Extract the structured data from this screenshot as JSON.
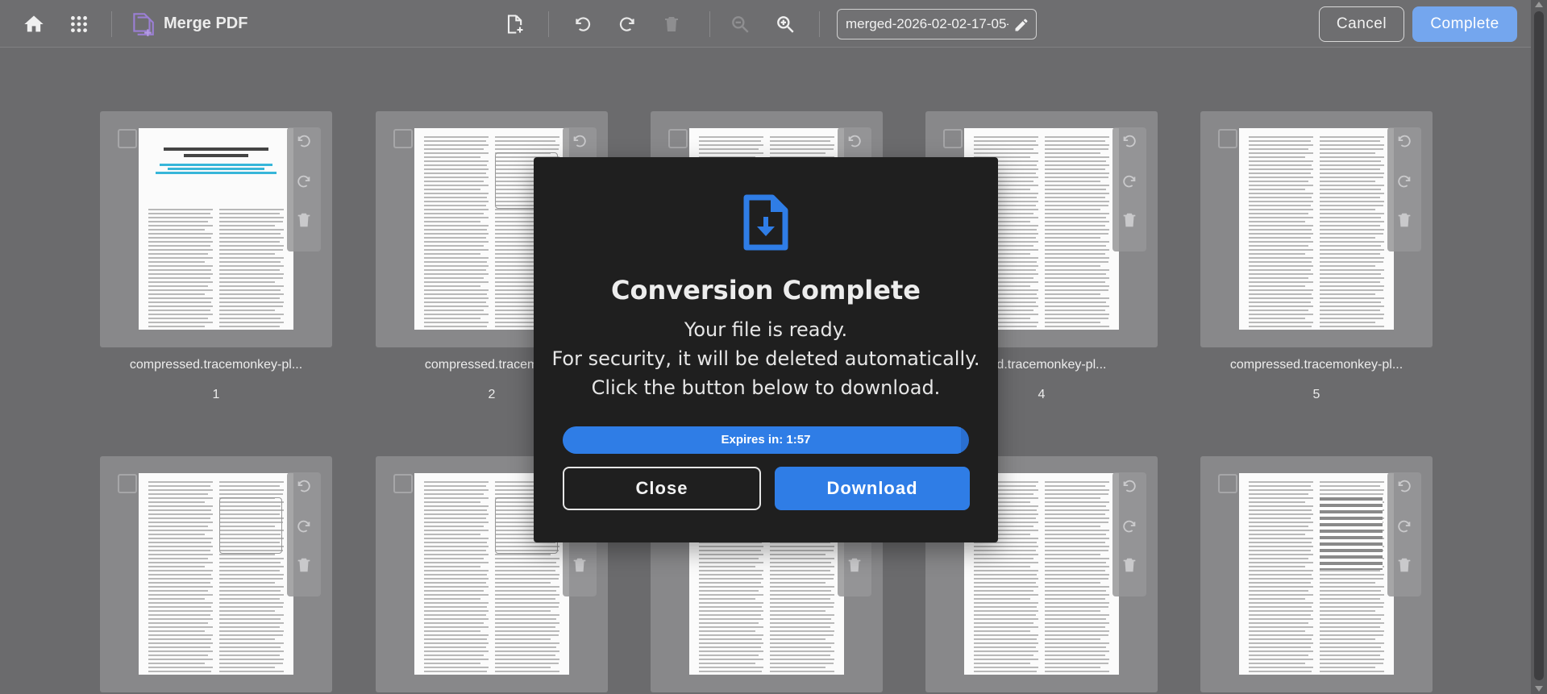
{
  "toolbar": {
    "title": "Merge PDF",
    "filename": "merged-2026-02-02-17-05-",
    "cancel_label": "Cancel",
    "complete_label": "Complete",
    "accent": "#74a6ee"
  },
  "pages": [
    {
      "label": "compressed.tracemonkey-pl...",
      "number": "1"
    },
    {
      "label": "compressed.tracemonk",
      "number": "2"
    },
    {
      "label": "ssed.tracemonkey-pl...",
      "number": "4"
    },
    {
      "label": "compressed.tracemonkey-pl...",
      "number": "5"
    }
  ],
  "dialog": {
    "title": "Conversion Complete",
    "line1": "Your file is ready.",
    "line2": "For security, it will be deleted automatically.",
    "line3": "Click the button below to download.",
    "timer_text": "Expires in: 1:57",
    "timer_progress": 0.98,
    "close_label": "Close",
    "download_label": "Download",
    "accent": "#2f7de6"
  }
}
